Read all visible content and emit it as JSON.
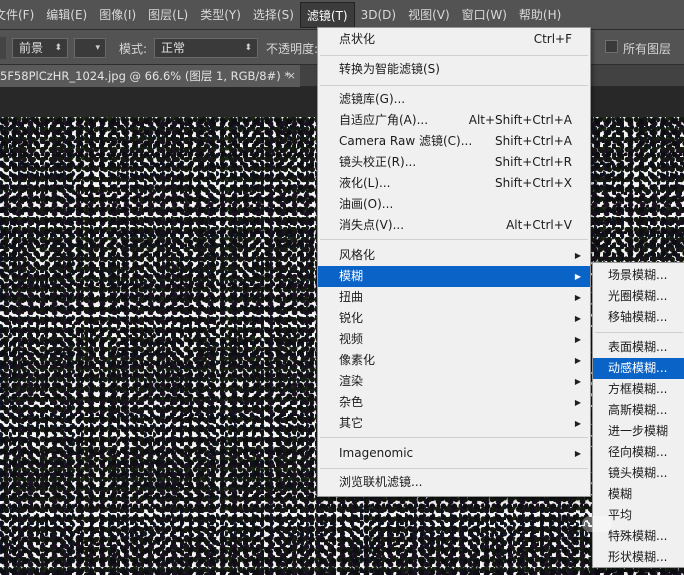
{
  "menubar": {
    "items": [
      {
        "label": "文件(F)"
      },
      {
        "label": "编辑(E)"
      },
      {
        "label": "图像(I)"
      },
      {
        "label": "图层(L)"
      },
      {
        "label": "类型(Y)"
      },
      {
        "label": "选择(S)"
      },
      {
        "label": "滤镜(T)"
      },
      {
        "label": "3D(D)"
      },
      {
        "label": "视图(V)"
      },
      {
        "label": "窗口(W)"
      },
      {
        "label": "帮助(H)"
      }
    ]
  },
  "options": {
    "fill_select": "前景",
    "mode_label": "模式:",
    "mode_select": "正常",
    "opacity_label": "不透明度:",
    "all_layers_label": "所有图层"
  },
  "document": {
    "tab_title": "5F58PlCzHR_1024.jpg @ 66.6% (图层 1, RGB/8#) *",
    "close": "×"
  },
  "filter_menu": {
    "last_filter": {
      "label": "点状化",
      "shortcut": "Ctrl+F"
    },
    "smart": {
      "label": "转换为智能滤镜(S)"
    },
    "gallery": [
      {
        "label": "滤镜库(G)...",
        "shortcut": ""
      },
      {
        "label": "自适应广角(A)...",
        "shortcut": "Alt+Shift+Ctrl+A"
      },
      {
        "label": "Camera Raw 滤镜(C)...",
        "shortcut": "Shift+Ctrl+A"
      },
      {
        "label": "镜头校正(R)...",
        "shortcut": "Shift+Ctrl+R"
      },
      {
        "label": "液化(L)...",
        "shortcut": "Shift+Ctrl+X"
      },
      {
        "label": "油画(O)...",
        "shortcut": ""
      },
      {
        "label": "消失点(V)...",
        "shortcut": "Alt+Ctrl+V"
      }
    ],
    "groups": [
      {
        "label": "风格化"
      },
      {
        "label": "模糊"
      },
      {
        "label": "扭曲"
      },
      {
        "label": "锐化"
      },
      {
        "label": "视频"
      },
      {
        "label": "像素化"
      },
      {
        "label": "渲染"
      },
      {
        "label": "杂色"
      },
      {
        "label": "其它"
      }
    ],
    "plugin": {
      "label": "Imagenomic"
    },
    "browse": {
      "label": "浏览联机滤镜..."
    }
  },
  "blur_submenu": {
    "gallery": [
      "场景模糊...",
      "光圈模糊...",
      "移轴模糊..."
    ],
    "items": [
      "表面模糊...",
      "动感模糊...",
      "方框模糊...",
      "高斯模糊...",
      "进一步模糊",
      "径向模糊...",
      "镜头模糊...",
      "模糊",
      "平均",
      "特殊模糊...",
      "形状模糊..."
    ]
  },
  "colors": {
    "highlight": "#0a64c8",
    "menu_bg": "#f0f0f0",
    "chrome": "#535353"
  }
}
